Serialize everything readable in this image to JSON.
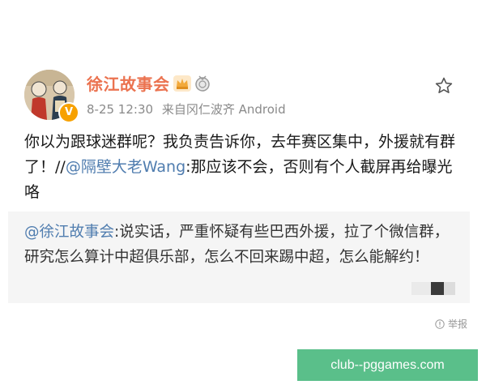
{
  "post": {
    "author": "徐江故事会",
    "time": "8-25 12:30",
    "source": "来自冈仁波齐 Android",
    "text_part1": "你以为跟球迷群呢？我负责告诉你，去年赛区集中，外援就有群了！//",
    "mention": "@隔壁大老Wang",
    "text_part2": ":那应该不会，否则有个人截屏再给曝光咯"
  },
  "quoted": {
    "mention": "@徐江故事会",
    "text": ":说实话，严重怀疑有些巴西外援，拉了个微信群，研究怎么算计中超俱乐部，怎么不回来踢中超，怎么能解约！"
  },
  "actions": {
    "report_label": "举报"
  },
  "watermark": {
    "text": "club--pggames.com"
  },
  "colors": {
    "username": "#eb7350",
    "mention": "#507daf",
    "quote_bg": "#f5f5f5",
    "watermark_bg": "#5abf8a"
  },
  "icons": {
    "verified": "verified-badge-icon",
    "favorite": "star-icon",
    "report": "report-icon"
  }
}
